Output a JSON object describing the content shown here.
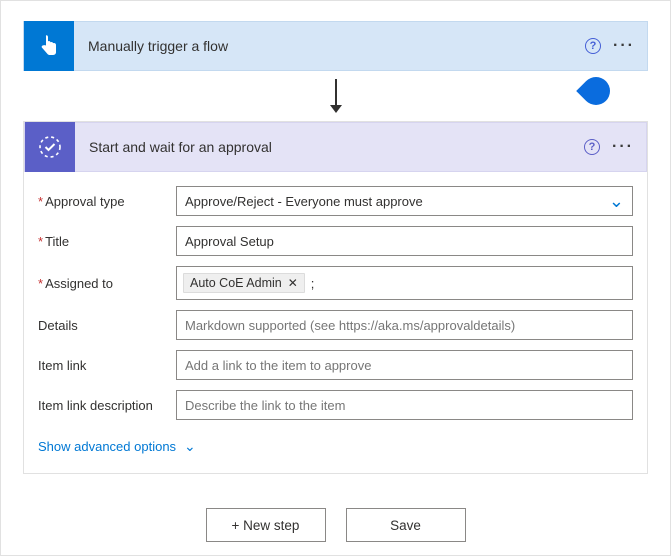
{
  "trigger": {
    "title": "Manually trigger a flow"
  },
  "action": {
    "title": "Start and wait for an approval",
    "fields": {
      "approval_type": {
        "label": "Approval type",
        "value": "Approve/Reject - Everyone must approve"
      },
      "title": {
        "label": "Title",
        "value": "Approval Setup"
      },
      "assigned_to": {
        "label": "Assigned to",
        "chip": "Auto CoE Admin",
        "after": ";"
      },
      "details": {
        "label": "Details",
        "placeholder": "Markdown supported (see https://aka.ms/approvaldetails)"
      },
      "item_link": {
        "label": "Item link",
        "placeholder": "Add a link to the item to approve"
      },
      "item_link_desc": {
        "label": "Item link description",
        "placeholder": "Describe the link to the item"
      }
    },
    "advanced": "Show advanced options"
  },
  "footer": {
    "new_step": "+ New step",
    "save": "Save"
  }
}
